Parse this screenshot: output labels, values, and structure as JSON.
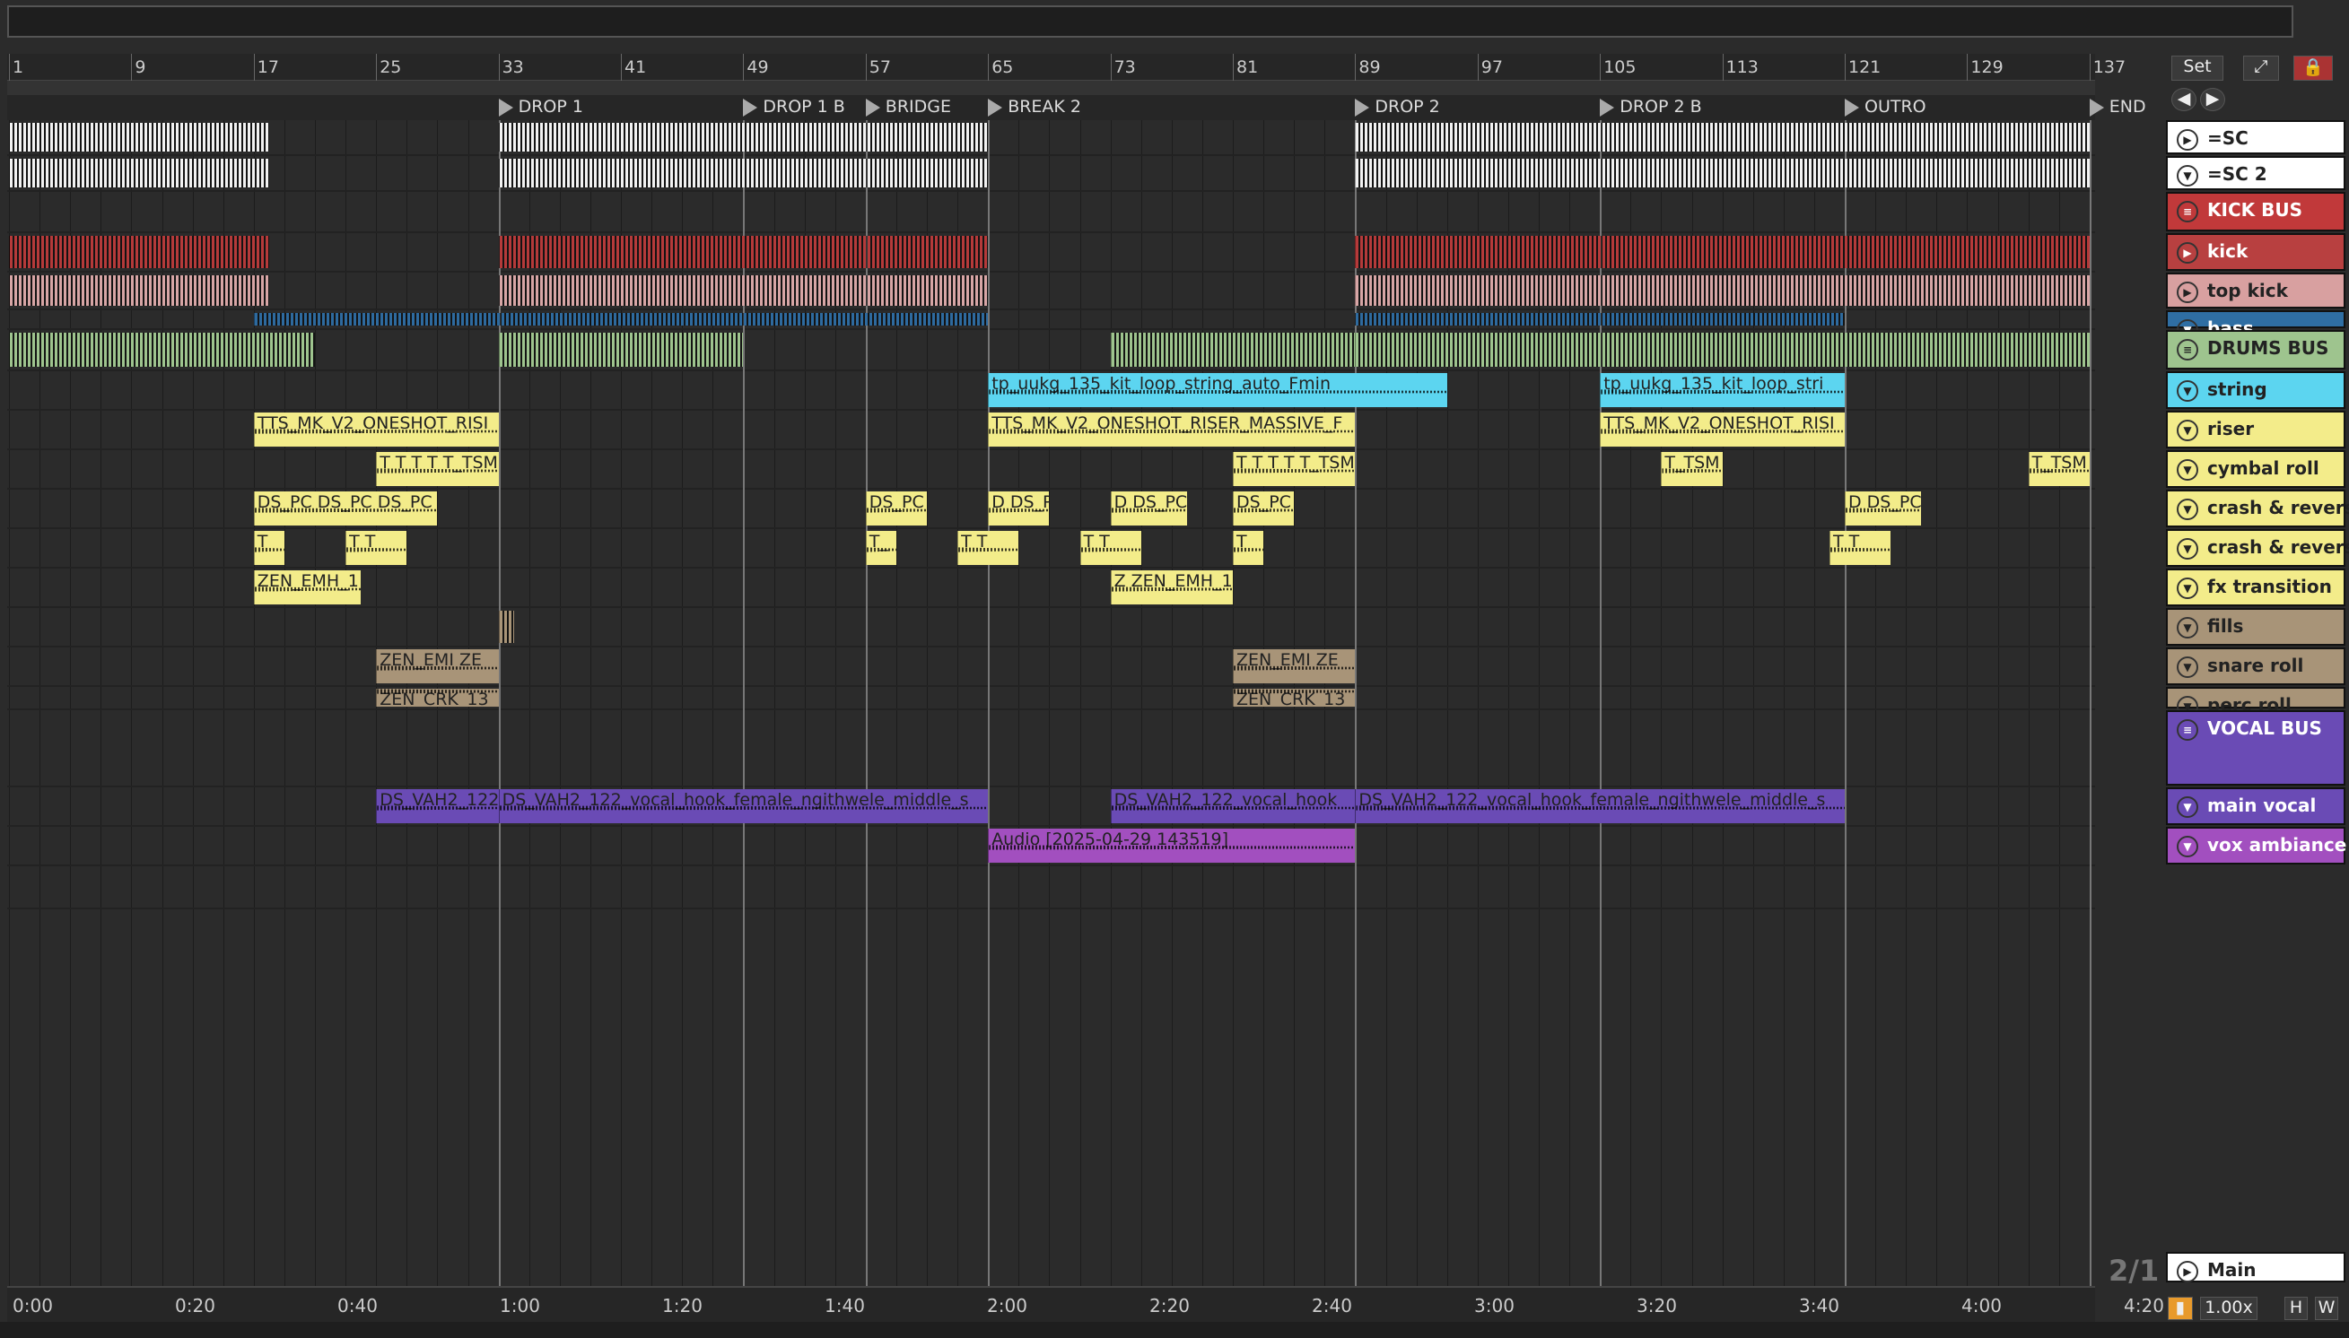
{
  "ruler": {
    "bars": [
      "1",
      "9",
      "17",
      "25",
      "33",
      "41",
      "49",
      "57",
      "65",
      "73",
      "81",
      "89",
      "97",
      "105",
      "113",
      "121",
      "129",
      "137"
    ]
  },
  "markers": [
    {
      "label": "DROP 1",
      "bar": 33
    },
    {
      "label": "DROP 1 B",
      "bar": 49
    },
    {
      "label": "BRIDGE",
      "bar": 57
    },
    {
      "label": "BREAK 2",
      "bar": 65
    },
    {
      "label": "DROP 2",
      "bar": 89
    },
    {
      "label": "DROP 2 B",
      "bar": 105
    },
    {
      "label": "OUTRO",
      "bar": 121
    },
    {
      "label": "END",
      "bar": 137
    }
  ],
  "times": [
    "0:00",
    "0:20",
    "0:40",
    "1:00",
    "1:20",
    "1:40",
    "2:00",
    "2:20",
    "2:40",
    "3:00",
    "3:20",
    "3:40",
    "4:00",
    "4:20"
  ],
  "controls": {
    "set": "Set",
    "zoom": "1.00x",
    "h": "H",
    "w": "W",
    "page": "2/1"
  },
  "tracks": [
    {
      "name": "=SC",
      "color": "#ffffff",
      "icon": "play-icon"
    },
    {
      "name": "=SC 2",
      "color": "#ffffff",
      "icon": "fold-icon"
    },
    {
      "name": "KICK BUS",
      "color": "#c1393a",
      "icon": "group-icon"
    },
    {
      "name": "kick",
      "color": "#b84040",
      "icon": "play-icon"
    },
    {
      "name": "top kick",
      "color": "#d8a0a0",
      "icon": "play-icon"
    },
    {
      "name": "bass",
      "color": "#2f6ea3",
      "icon": "fold-icon"
    },
    {
      "name": "DRUMS BUS",
      "color": "#9ec48e",
      "icon": "group-icon"
    },
    {
      "name": "string",
      "color": "#5cd5f0",
      "icon": "fold-icon"
    },
    {
      "name": "riser",
      "color": "#f3ec8a",
      "icon": "fold-icon"
    },
    {
      "name": "cymbal roll",
      "color": "#f3ec8a",
      "icon": "fold-icon"
    },
    {
      "name": "crash & revers",
      "color": "#f3ec8a",
      "icon": "fold-icon"
    },
    {
      "name": "crash & revers",
      "color": "#f3ec8a",
      "icon": "fold-icon"
    },
    {
      "name": "fx transition",
      "color": "#f3ec8a",
      "icon": "fold-icon"
    },
    {
      "name": "fills",
      "color": "#a89478",
      "icon": "fold-icon"
    },
    {
      "name": "snare roll",
      "color": "#a89478",
      "icon": "fold-icon"
    },
    {
      "name": "perc roll",
      "color": "#a89478",
      "icon": "fold-icon"
    },
    {
      "name": "VOCAL BUS",
      "color": "#6a4bb5",
      "icon": "group-icon"
    },
    {
      "name": "main vocal",
      "color": "#6a4bb5",
      "icon": "fold-icon"
    },
    {
      "name": "vox ambiance",
      "color": "#a24fbf",
      "icon": "fold-icon"
    },
    {
      "name": "Main",
      "color": "#ffffff",
      "icon": "play-icon"
    }
  ],
  "clips": [
    {
      "track": 7,
      "bar": 65,
      "len": 30,
      "name": "tp_uukg_135_kit_loop_string_auto_Fmin"
    },
    {
      "track": 7,
      "bar": 105,
      "len": 16,
      "name": "tp_uukg_135_kit_loop_stri"
    },
    {
      "track": 8,
      "bar": 17,
      "len": 16,
      "name": "TTS_MK_V2_ONESHOT_RISI"
    },
    {
      "track": 8,
      "bar": 65,
      "len": 24,
      "name": "TTS_MK_V2_ONESHOT_RISER_MASSIVE_F"
    },
    {
      "track": 8,
      "bar": 105,
      "len": 16,
      "name": "TTS_MK_V2_ONESHOT_RISI"
    },
    {
      "track": 9,
      "bar": 25,
      "len": 8,
      "name": "T T T T T_TSM"
    },
    {
      "track": 9,
      "bar": 81,
      "len": 8,
      "name": "T T T T T_TSM"
    },
    {
      "track": 9,
      "bar": 109,
      "len": 4,
      "name": "T_TSM"
    },
    {
      "track": 9,
      "bar": 133,
      "len": 4,
      "name": "T_TSM"
    },
    {
      "track": 10,
      "bar": 17,
      "len": 12,
      "name": "DS_PC DS_PC DS_PC"
    },
    {
      "track": 10,
      "bar": 57,
      "len": 4,
      "name": "DS_PC"
    },
    {
      "track": 10,
      "bar": 65,
      "len": 4,
      "name": "D DS_PC"
    },
    {
      "track": 10,
      "bar": 73,
      "len": 5,
      "name": "D DS_PC"
    },
    {
      "track": 10,
      "bar": 81,
      "len": 4,
      "name": "DS_PC"
    },
    {
      "track": 10,
      "bar": 121,
      "len": 5,
      "name": "D DS_PC"
    },
    {
      "track": 11,
      "bar": 17,
      "len": 2,
      "name": "T"
    },
    {
      "track": 11,
      "bar": 23,
      "len": 4,
      "name": "T T"
    },
    {
      "track": 11,
      "bar": 57,
      "len": 2,
      "name": "T_"
    },
    {
      "track": 11,
      "bar": 63,
      "len": 4,
      "name": "T T"
    },
    {
      "track": 11,
      "bar": 71,
      "len": 4,
      "name": "T T"
    },
    {
      "track": 11,
      "bar": 81,
      "len": 2,
      "name": "T"
    },
    {
      "track": 11,
      "bar": 120,
      "len": 4,
      "name": "T T"
    },
    {
      "track": 12,
      "bar": 17,
      "len": 7,
      "name": "ZEN_EMH_1"
    },
    {
      "track": 12,
      "bar": 73,
      "len": 8,
      "name": "Z ZEN_EMH_1"
    },
    {
      "track": 14,
      "bar": 25,
      "len": 8,
      "name": "ZEN_EMI ZE"
    },
    {
      "track": 14,
      "bar": 81,
      "len": 8,
      "name": "ZEN_EMI ZE"
    },
    {
      "track": 15,
      "bar": 25,
      "len": 8,
      "name": "ZEN_CRK_13"
    },
    {
      "track": 15,
      "bar": 81,
      "len": 8,
      "name": "ZEN_CRK_13"
    },
    {
      "track": 17,
      "bar": 25,
      "len": 8,
      "name": "DS_VAH2_122"
    },
    {
      "track": 17,
      "bar": 33,
      "len": 32,
      "name": "DS_VAH2_122_vocal_hook_female_ngithwele_middle_s"
    },
    {
      "track": 17,
      "bar": 73,
      "len": 16,
      "name": "DS_VAH2_122_vocal_hook"
    },
    {
      "track": 17,
      "bar": 89,
      "len": 32,
      "name": "DS_VAH2_122_vocal_hook_female_ngithwele_middle_s"
    },
    {
      "track": 18,
      "bar": 65,
      "len": 24,
      "name": "Audio [2025-04-29 143519]"
    }
  ]
}
